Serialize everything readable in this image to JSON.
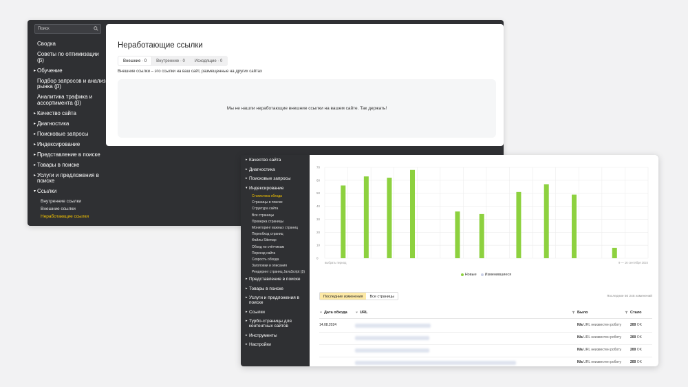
{
  "window1": {
    "search": {
      "placeholder": "Поиск"
    },
    "nav": [
      {
        "label": "Сводка",
        "kind": "item"
      },
      {
        "label": "Советы по оптимизации (β)",
        "kind": "item"
      },
      {
        "label": "Обучение",
        "kind": "arrow"
      },
      {
        "label": "Подбор запросов и анализ рынка (β)",
        "kind": "item"
      },
      {
        "label": "Аналитика трафика и ассортимента (β)",
        "kind": "item"
      },
      {
        "label": "Качество сайта",
        "kind": "arrow"
      },
      {
        "label": "Диагностика",
        "kind": "arrow"
      },
      {
        "label": "Поисковые запросы",
        "kind": "arrow"
      },
      {
        "label": "Индексирование",
        "kind": "arrow"
      },
      {
        "label": "Представление в поиске",
        "kind": "arrow"
      },
      {
        "label": "Товары в поиске",
        "kind": "arrow"
      },
      {
        "label": "Услуги и предложения в поиске",
        "kind": "arrow"
      },
      {
        "label": "Ссылки",
        "kind": "open"
      },
      {
        "label": "Внутренние ссылки",
        "kind": "sub"
      },
      {
        "label": "Внешние ссылки",
        "kind": "sub"
      },
      {
        "label": "Неработающие ссылки",
        "kind": "sub-active"
      }
    ],
    "title": "Неработающие ссылки",
    "tabs": [
      {
        "label": "Внешние · 0",
        "selected": true
      },
      {
        "label": "Внутренние · 0",
        "selected": false
      },
      {
        "label": "Исходящие · 0",
        "selected": false
      }
    ],
    "hint": "Внешние ссылки – это ссылки на ваш сайт, размещенные на других сайтах",
    "empty_message": "Мы не нашли неработающие внешние ссылки на вашем сайте. Так держать!"
  },
  "window2": {
    "nav": [
      {
        "label": "Качество сайта",
        "kind": "arrow"
      },
      {
        "label": "Диагностика",
        "kind": "arrow"
      },
      {
        "label": "Поисковые запросы",
        "kind": "arrow"
      },
      {
        "label": "Индексирование",
        "kind": "open"
      },
      {
        "label": "Статистика обхода",
        "kind": "sub-active"
      },
      {
        "label": "Страницы в поиске",
        "kind": "sub"
      },
      {
        "label": "Структура сайта",
        "kind": "sub"
      },
      {
        "label": "Все страницы",
        "kind": "sub"
      },
      {
        "label": "Проверка страницы",
        "kind": "sub"
      },
      {
        "label": "Мониторинг важных страниц",
        "kind": "sub"
      },
      {
        "label": "Переобход страниц",
        "kind": "sub"
      },
      {
        "label": "Файлы Sitemap",
        "kind": "sub"
      },
      {
        "label": "Обход по счётчикам",
        "kind": "sub"
      },
      {
        "label": "Переезд сайта",
        "kind": "sub"
      },
      {
        "label": "Скорость обхода",
        "kind": "sub"
      },
      {
        "label": "Заголовки и описания",
        "kind": "sub"
      },
      {
        "label": "Рендеринг страниц JavaScript (β)",
        "kind": "sub"
      },
      {
        "label": "Представление в поиске",
        "kind": "arrow"
      },
      {
        "label": "Товары в поиске",
        "kind": "arrow"
      },
      {
        "label": "Услуги и предложения в поиске",
        "kind": "arrow"
      },
      {
        "label": "Ссылки",
        "kind": "arrow"
      },
      {
        "label": "Турбо-страницы для контентных сайтов",
        "kind": "arrow"
      },
      {
        "label": "Инструменты",
        "kind": "arrow"
      },
      {
        "label": "Настройки",
        "kind": "arrow"
      }
    ],
    "legend": [
      {
        "label": "Новые",
        "color": "#8dd13f"
      },
      {
        "label": "Изменившиеся",
        "color": "#c9cfe6"
      }
    ],
    "tabs": [
      {
        "label": "Последние изменения",
        "selected": true
      },
      {
        "label": "Все страницы",
        "selected": false
      }
    ],
    "total_note": "Последние 50 245 изменений",
    "columns": {
      "date": "Дата обхода",
      "url": "URL",
      "was": "Было",
      "now": "Стало"
    },
    "rows": [
      {
        "date": "14.08.2024",
        "was_code": "N/a",
        "was_text": "URL неизвестен роботу",
        "now_code": "200",
        "now_text": "OK"
      },
      {
        "date": "",
        "was_code": "N/a",
        "was_text": "URL неизвестен роботу",
        "now_code": "200",
        "now_text": "OK"
      },
      {
        "date": "",
        "was_code": "N/a",
        "was_text": "URL неизвестен роботу",
        "now_code": "200",
        "now_text": "OK"
      },
      {
        "date": "",
        "was_code": "N/a",
        "was_text": "URL неизвестен роботу",
        "now_code": "200",
        "now_text": "OK"
      }
    ]
  },
  "chart_data": {
    "type": "bar",
    "ylim": [
      0,
      70
    ],
    "yticks": [
      0,
      10,
      20,
      30,
      40,
      50,
      60,
      70
    ],
    "categories": [
      "1",
      "2",
      "3",
      "4",
      "5",
      "6",
      "7",
      "8",
      "9",
      "10"
    ],
    "series": [
      {
        "name": "Новые",
        "color": "#8dd13f",
        "values": [
          56,
          63,
          62,
          68,
          36,
          34,
          51,
          57,
          49,
          8
        ]
      }
    ],
    "xlabel_left": "выбрать период",
    "xlabel_right": "9 — 16 сентября 2024",
    "grid": true
  }
}
